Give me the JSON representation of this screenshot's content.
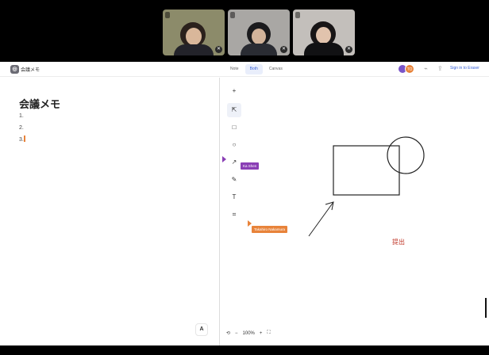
{
  "participants": [
    {
      "name": "",
      "bg": "#8c8b6a",
      "head": "#2b211c",
      "face": "#d9b79a",
      "shirt": "#23232a"
    },
    {
      "name": "",
      "bg": "#a9a7a4",
      "head": "#1b1b1d",
      "face": "#d2b39a",
      "shirt": "#2a2c33"
    },
    {
      "name": "",
      "bg": "#c3bfbb",
      "head": "#181516",
      "face": "#e1c3ad",
      "shirt": "#111113"
    }
  ],
  "topbar": {
    "logo_char": "◎",
    "doc_title": "会議メモ",
    "views": [
      "Note",
      "Both",
      "Canvas"
    ],
    "avatars": [
      {
        "initials": "",
        "color": "#7a55c9"
      },
      {
        "initials": "TO",
        "color": "#e8833a"
      }
    ],
    "sign_in": "Sign in to Eraser"
  },
  "document": {
    "heading": "会議メモ",
    "lines": [
      "1.",
      "2.",
      "3."
    ],
    "format_button": "A"
  },
  "canvas": {
    "tools": [
      {
        "icon": "+",
        "name": "add-tool-icon"
      },
      {
        "icon": "⇱",
        "name": "select-tool-icon"
      },
      {
        "icon": "□",
        "name": "rectangle-tool-icon"
      },
      {
        "icon": "○",
        "name": "ellipse-tool-icon"
      },
      {
        "icon": "↗",
        "name": "arrow-tool-icon"
      },
      {
        "icon": "✎",
        "name": "pen-tool-icon"
      },
      {
        "icon": "T",
        "name": "text-tool-icon"
      },
      {
        "icon": "⌗",
        "name": "frame-tool-icon"
      }
    ],
    "cursors": [
      {
        "label": "Ka Shen",
        "color": "#8a3fb5"
      },
      {
        "label": "Takahiro Nakamura",
        "color": "#e8833a"
      }
    ],
    "label_text": "提出",
    "zoom": [
      "⟲",
      "−",
      "100%",
      "+",
      "⛶"
    ]
  },
  "colors": {
    "accent": "#3b63d9",
    "label_red": "#c0392b"
  }
}
